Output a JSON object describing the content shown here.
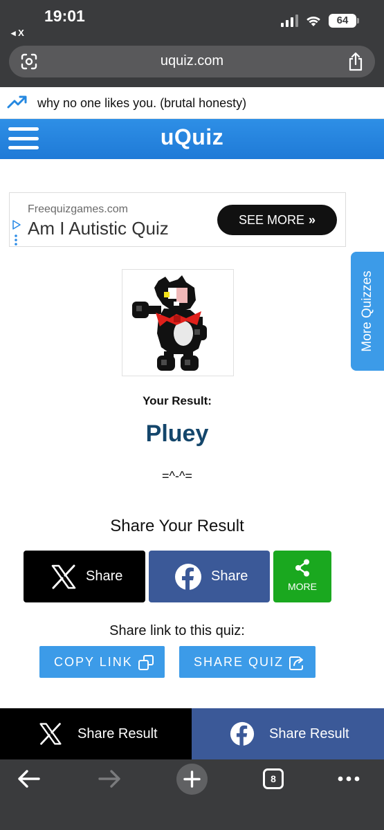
{
  "status_bar": {
    "time": "19:01",
    "back_app": "◂ X",
    "battery": "64"
  },
  "browser": {
    "url": "uquiz.com"
  },
  "trending": {
    "text": "why no one likes you. (brutal honesty)"
  },
  "site": {
    "logo": "uQuiz"
  },
  "ad": {
    "site": "Freequizgames.com",
    "title": "Am I Autistic Quiz",
    "button": "SEE MORE",
    "arrow": "»"
  },
  "side_tab": {
    "label": "More Quizzes"
  },
  "result": {
    "label": "Your Result:",
    "name": "Pluey",
    "description": "=^-^="
  },
  "share": {
    "heading": "Share Your Result",
    "x_label": "Share",
    "fb_label": "Share",
    "more_label": "MORE",
    "link_label": "Share link to this quiz:",
    "copy_link": "COPY LINK",
    "share_quiz": "SHARE QUIZ"
  },
  "sticky": {
    "x_label": "Share Result",
    "fb_label": "Share Result"
  },
  "toolbar": {
    "tab_count": "8"
  },
  "colors": {
    "brand_blue": "#2588e0",
    "facebook": "#3b5998",
    "more_green": "#1aa81f",
    "result_name": "#14466b",
    "link_button": "#3c9be8"
  }
}
